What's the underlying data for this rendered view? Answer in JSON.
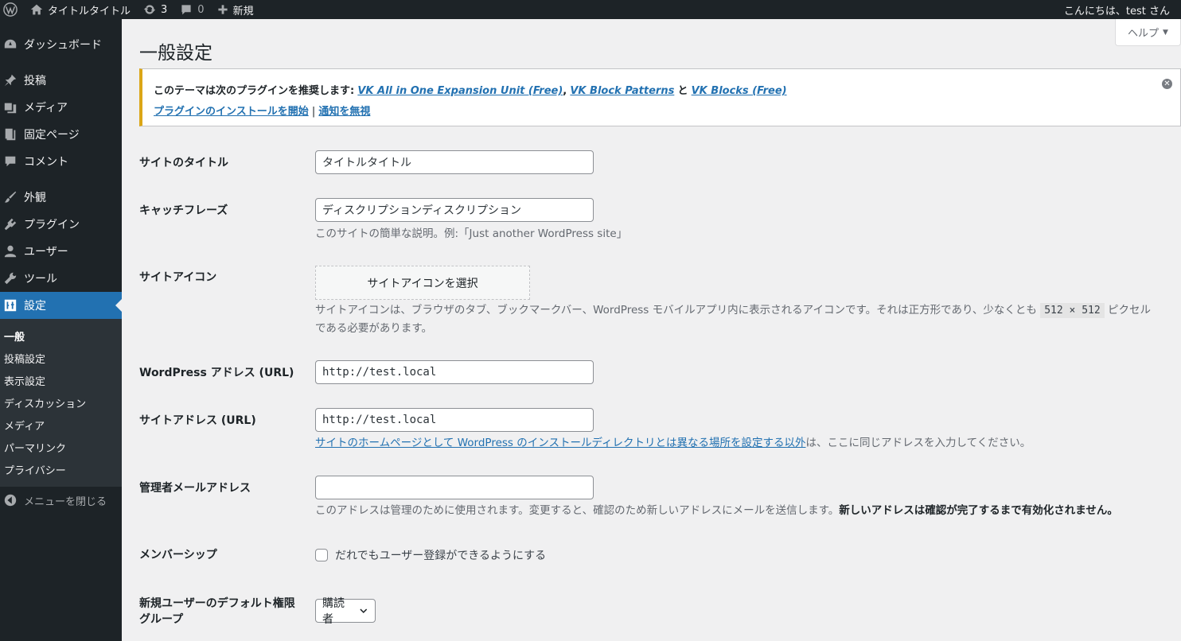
{
  "adminbar": {
    "site_name": "タイトルタイトル",
    "updates_count": "3",
    "comments_count": "0",
    "new_label": "新規",
    "greeting": "こんにちは、test さん"
  },
  "sidebar": {
    "items": [
      {
        "label": "ダッシュボード",
        "icon": "dashboard-icon"
      },
      {
        "label": "投稿",
        "icon": "pin-icon"
      },
      {
        "label": "メディア",
        "icon": "media-icon"
      },
      {
        "label": "固定ページ",
        "icon": "page-icon"
      },
      {
        "label": "コメント",
        "icon": "comment-icon"
      },
      {
        "label": "外観",
        "icon": "brush-icon"
      },
      {
        "label": "プラグイン",
        "icon": "plugin-icon"
      },
      {
        "label": "ユーザー",
        "icon": "user-icon"
      },
      {
        "label": "ツール",
        "icon": "wrench-icon"
      },
      {
        "label": "設定",
        "icon": "settings-icon"
      }
    ],
    "submenu": [
      "一般",
      "投稿設定",
      "表示設定",
      "ディスカッション",
      "メディア",
      "パーマリンク",
      "プライバシー"
    ],
    "collapse_label": "メニューを閉じる"
  },
  "help_label": "ヘルプ",
  "page_title": "一般設定",
  "notice": {
    "lead": "このテーマは次のプラグインを推奨します:",
    "plugin1": "VK All in One Expansion Unit (Free)",
    "sep1": ",",
    "plugin2": "VK Block Patterns",
    "and": "と",
    "plugin3": "VK Blocks (Free)",
    "install_link": "プラグインのインストールを開始",
    "pipe": "|",
    "dismiss_link": "通知を無視"
  },
  "form": {
    "site_title_label": "サイトのタイトル",
    "site_title_value": "タイトルタイトル",
    "tagline_label": "キャッチフレーズ",
    "tagline_value": "ディスクリプションディスクリプション",
    "tagline_desc": "このサイトの簡単な説明。例:「Just another WordPress site」",
    "site_icon_label": "サイトアイコン",
    "site_icon_button": "サイトアイコンを選択",
    "site_icon_desc_1": "サイトアイコンは、ブラウザのタブ、ブックマークバー、WordPress モバイルアプリ内に表示されるアイコンです。それは正方形であり、少なくとも",
    "site_icon_code": "512 × 512",
    "site_icon_desc_2": "ピクセル",
    "site_icon_desc_3": "である必要があります。",
    "wp_address_label": "WordPress アドレス (URL)",
    "wp_address_value": "http://test.local",
    "site_address_label": "サイトアドレス (URL)",
    "site_address_value": "http://test.local",
    "site_address_link": "サイトのホームページとして WordPress のインストールディレクトリとは異なる場所を設定する以外",
    "site_address_desc": "は、ここに同じアドレスを入力してください。",
    "admin_email_label": "管理者メールアドレス",
    "admin_email_value": "",
    "admin_email_desc": "このアドレスは管理のために使用されます。変更すると、確認のため新しいアドレスにメールを送信します。",
    "admin_email_desc_bold": "新しいアドレスは確認が完了するまで有効化されません。",
    "membership_label": "メンバーシップ",
    "membership_checkbox": "だれでもユーザー登録ができるようにする",
    "default_role_label_1": "新規ユーザーのデフォルト権限",
    "default_role_label_2": "グループ",
    "default_role_value": "購読者"
  }
}
